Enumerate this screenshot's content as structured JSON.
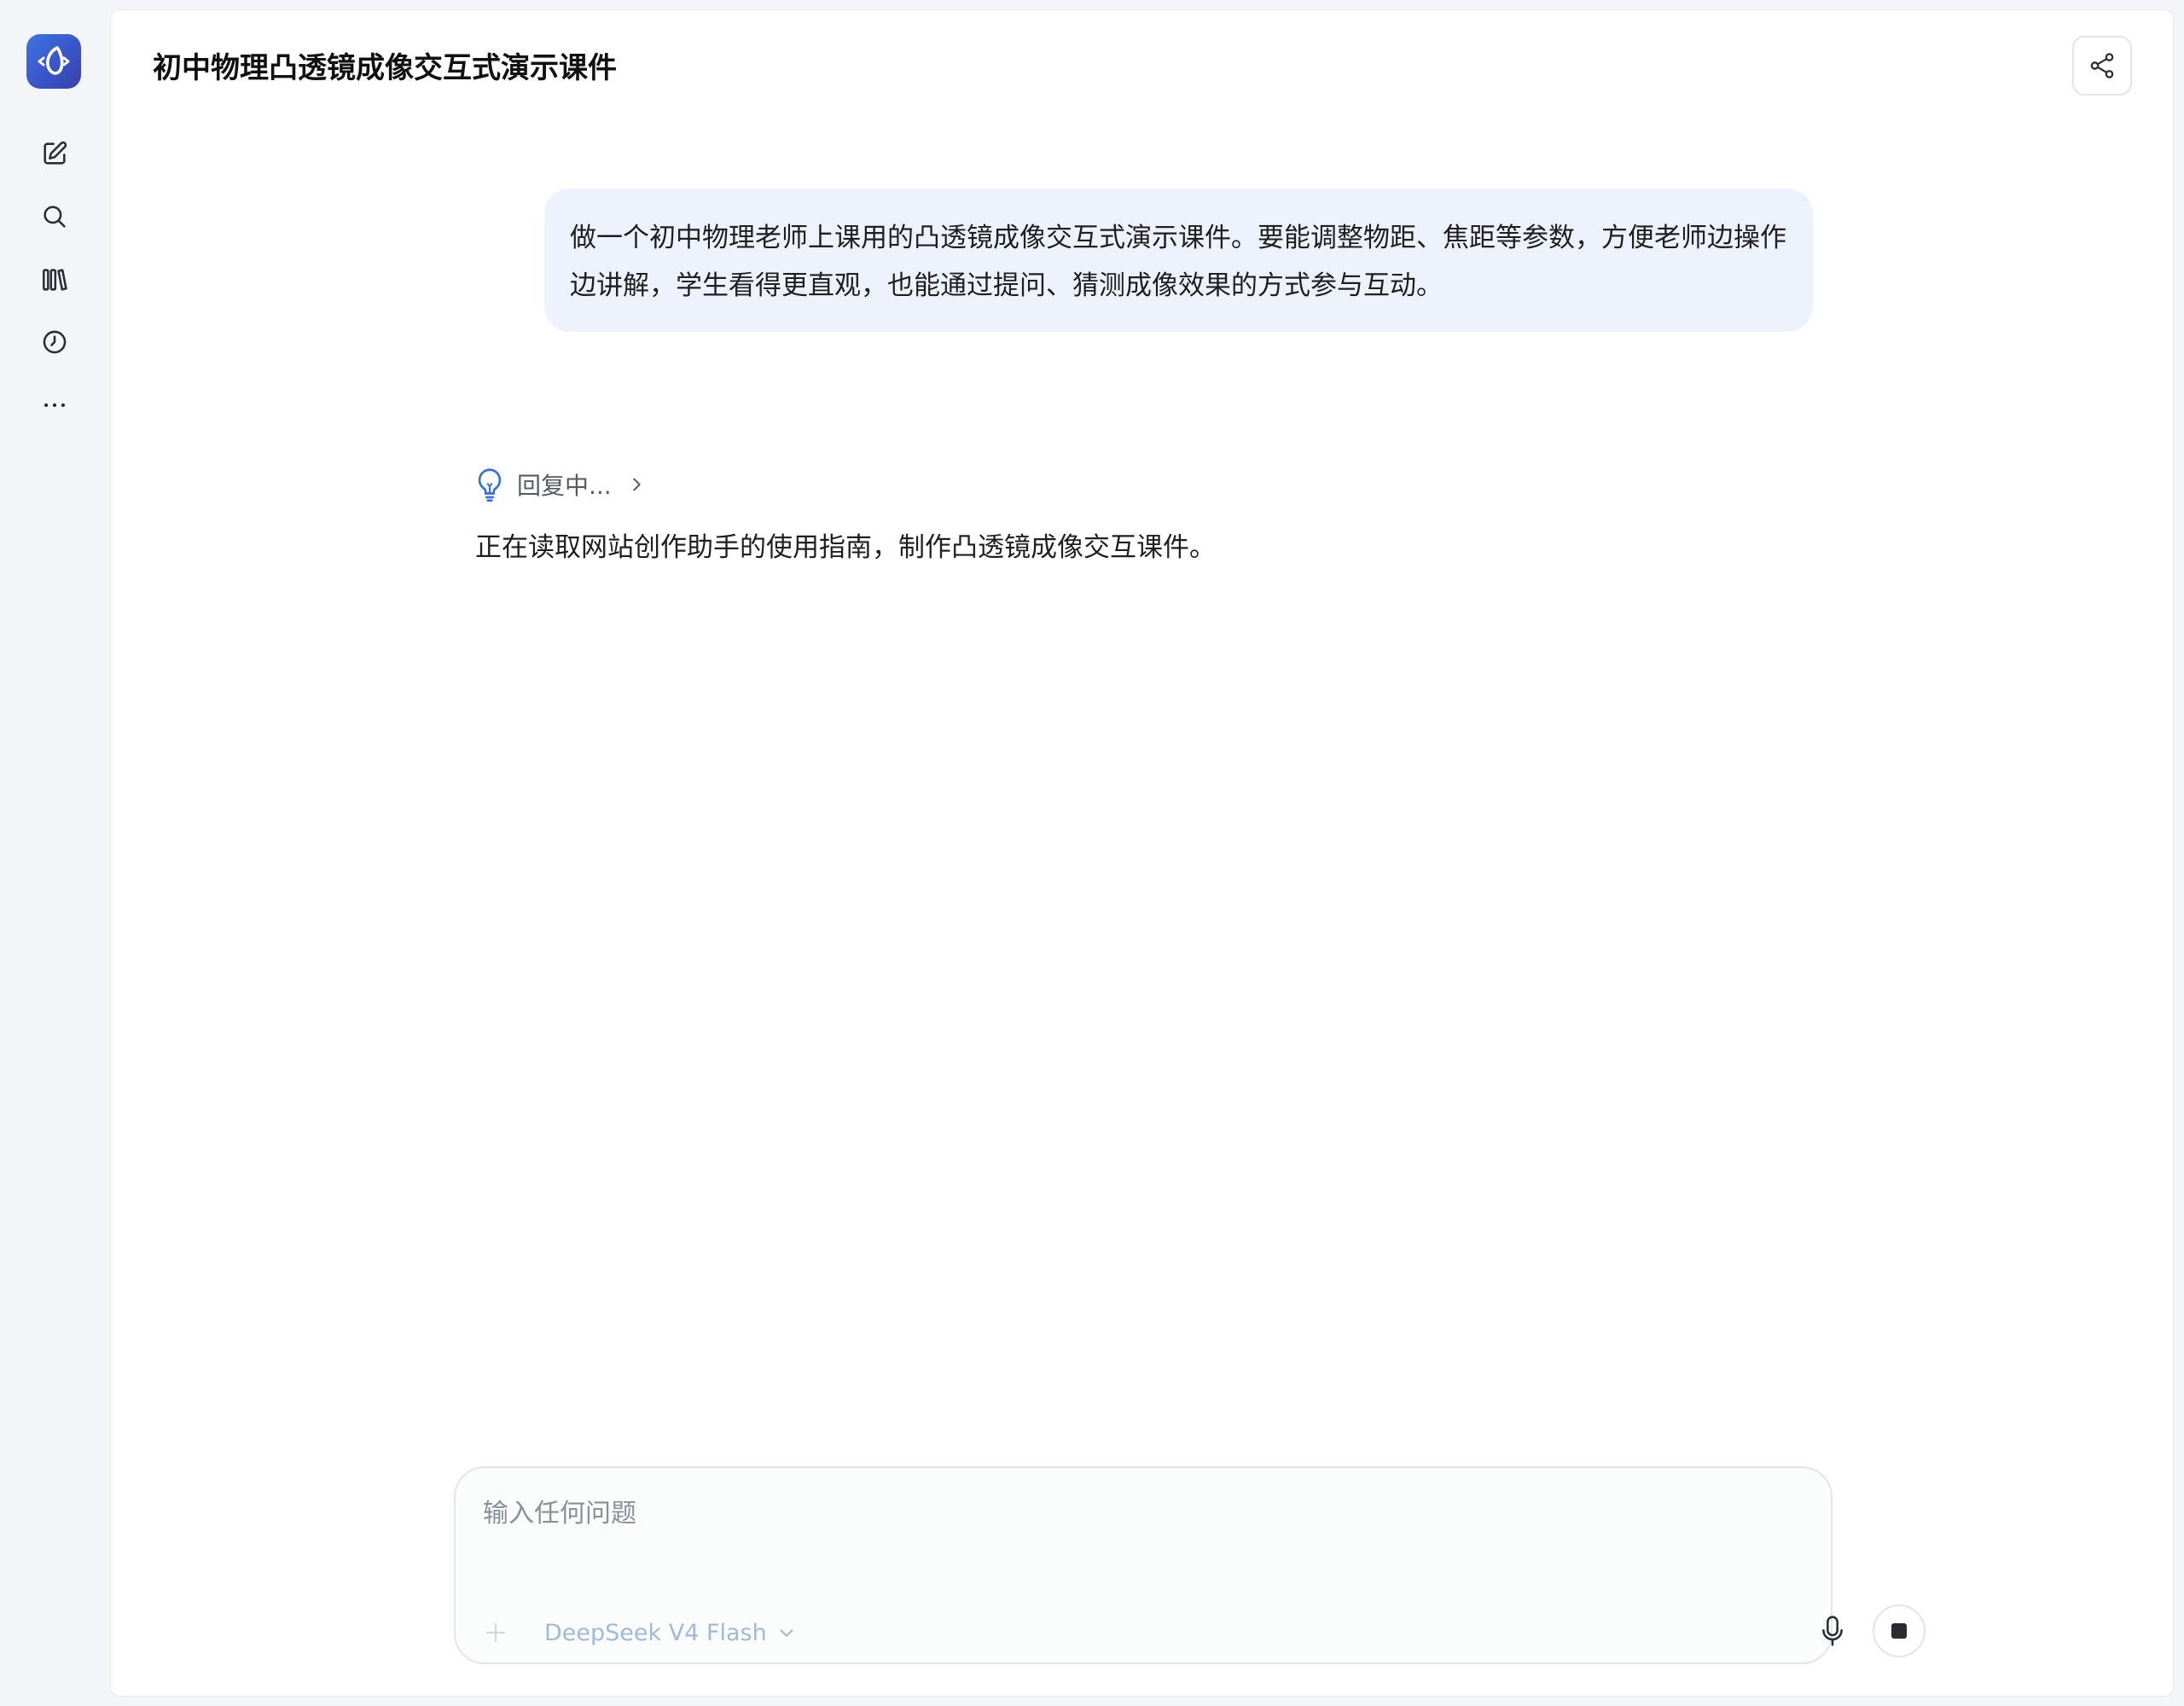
{
  "app": {
    "logo_icon": "app-logo-icon",
    "brand_colors": [
      "#3f74e0",
      "#3b3fa8"
    ]
  },
  "sidebar": {
    "items": [
      {
        "name": "new-chat",
        "icon": "edit-icon"
      },
      {
        "name": "search",
        "icon": "search-icon"
      },
      {
        "name": "library",
        "icon": "library-icon"
      },
      {
        "name": "history",
        "icon": "clock-icon"
      },
      {
        "name": "more",
        "icon": "more-icon"
      }
    ]
  },
  "header": {
    "title": "初中物理凸透镜成像交互式演示课件",
    "share_icon": "share-icon"
  },
  "conversation": {
    "user_message": "做一个初中物理老师上课用的凸透镜成像交互式演示课件。要能调整物距、焦距等参数，方便老师边操作边讲解，学生看得更直观，也能通过提问、猜测成像效果的方式参与互动。",
    "assistant": {
      "status": "回复中...",
      "status_icon": "lightbulb-icon",
      "reply": "正在读取网站创作助手的使用指南，制作凸透镜成像交互课件。"
    }
  },
  "composer": {
    "placeholder": "输入任何问题",
    "value": "",
    "model_name": "DeepSeek V4 Flash",
    "attach_icon": "plus-icon",
    "mic_icon": "microphone-icon",
    "stop_icon": "stop-icon"
  },
  "colors": {
    "user_bubble": "#edf2fd",
    "accent": "#3b6fd8",
    "model_text": "#a3b8d6"
  }
}
